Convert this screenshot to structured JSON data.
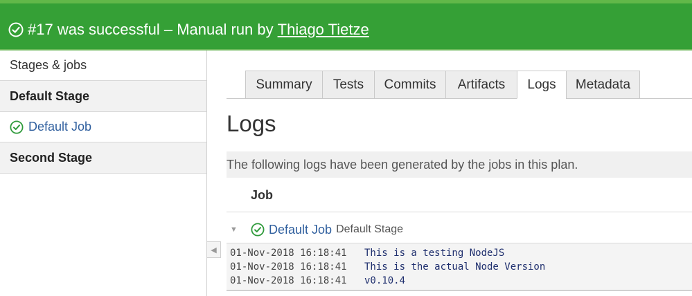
{
  "header": {
    "status_text": "#17 was successful – Manual run by",
    "user_link": "Thiago Tietze",
    "icon": "check-circle-icon",
    "bg_color": "#35a036"
  },
  "sidebar": {
    "title": "Stages & jobs",
    "stages": [
      {
        "label": "Default Stage"
      },
      {
        "label": "Default Job",
        "status_icon": "check-circle-icon",
        "is_job": true
      },
      {
        "label": "Second Stage"
      }
    ],
    "collapse_icon": "chevron-left-icon"
  },
  "tabs": [
    {
      "label": "Summary",
      "active": false
    },
    {
      "label": "Tests",
      "active": false
    },
    {
      "label": "Commits",
      "active": false
    },
    {
      "label": "Artifacts",
      "active": false
    },
    {
      "label": "Logs",
      "active": true
    },
    {
      "label": "Metadata",
      "active": false
    }
  ],
  "main": {
    "title": "Logs",
    "description": "The following logs have been generated by the jobs in this plan.",
    "column_header": "Job",
    "job": {
      "name": "Default Job",
      "stage": "Default Stage",
      "status_icon": "check-circle-icon",
      "toggle_icon": "triangle-down-icon"
    },
    "logs": [
      {
        "timestamp": "01-Nov-2018 16:18:41",
        "message": "This is a testing NodeJS"
      },
      {
        "timestamp": "01-Nov-2018 16:18:41",
        "message": "This is the actual Node Version"
      },
      {
        "timestamp": "01-Nov-2018 16:18:41",
        "message": "v0.10.4"
      }
    ]
  },
  "colors": {
    "success": "#35a036",
    "link": "#2f5f9e",
    "log_message": "#1f2f6e"
  }
}
